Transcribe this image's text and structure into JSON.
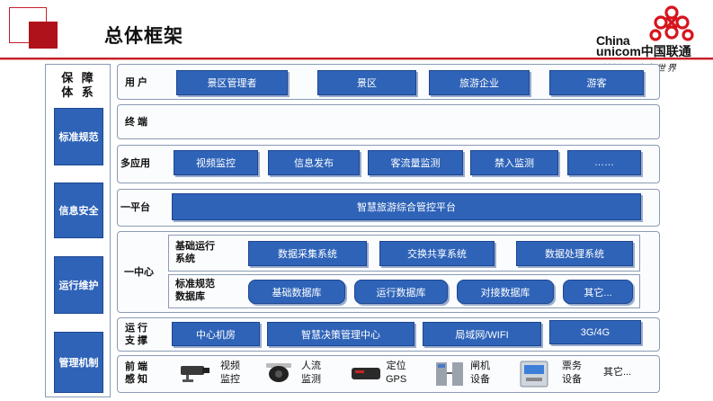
{
  "header": {
    "title": "总体框架",
    "logo_china": "China",
    "logo_unicom": "unicom中国联通",
    "logo_slogan": "创新 · 改变世界",
    "accent": "#c81e28"
  },
  "left_column": {
    "title_line1": "保 障",
    "title_line2": "体 系",
    "items": [
      "标准规范",
      "信息安全",
      "运行维护",
      "管理机制"
    ],
    "box_color": "#2e63b8"
  },
  "rows": {
    "users": {
      "label": "用 户",
      "items": [
        "景区管理者",
        "景区",
        "旅游企业",
        "游客"
      ]
    },
    "terminal": {
      "label": "终 端"
    },
    "apps": {
      "label": "多应用",
      "items": [
        "视频监控",
        "信息发布",
        "客流量监测",
        "禁入监测",
        "……"
      ]
    },
    "platform": {
      "label": "一平台",
      "bar": "智慧旅游综合管控平台"
    },
    "center": {
      "label": "一中心",
      "basic_label_1": "基础运行",
      "basic_label_2": "系统",
      "basic_items": [
        "数据采集系统",
        "交换共享系统",
        "数据处理系统"
      ],
      "db_label_1": "标准规范",
      "db_label_2": "数据库",
      "db_items": [
        "基础数据库",
        "运行数据库",
        "对接数据库",
        "其它..."
      ]
    },
    "support": {
      "label_1": "运 行",
      "label_2": "支 撑",
      "items": [
        "中心机房",
        "智慧决策管理中心",
        "局域网/WIFI",
        "3G/4G"
      ]
    },
    "sensing": {
      "label_1": "前 端",
      "label_2": "感 知",
      "items": [
        {
          "line1": "视频",
          "line2": "监控",
          "icon": "camera-icon"
        },
        {
          "line1": "人流",
          "line2": "监测",
          "icon": "dome-camera-icon"
        },
        {
          "line1": "定位",
          "line2": "GPS",
          "icon": "gps-device-icon"
        },
        {
          "line1": "闸机",
          "line2": "设备",
          "icon": "turnstile-icon"
        },
        {
          "line1": "票务",
          "line2": "设备",
          "icon": "ticket-machine-icon"
        }
      ],
      "other": "其它..."
    }
  }
}
